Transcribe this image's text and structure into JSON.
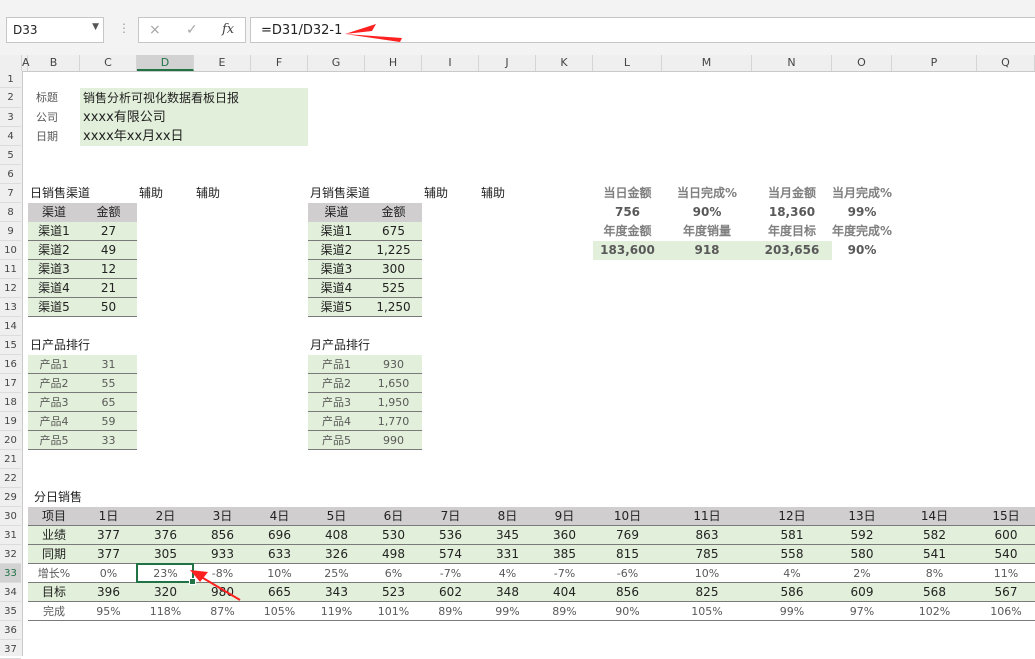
{
  "formula_bar": {
    "name_box": "D33",
    "formula": "=D31/D32-1",
    "cancel_icon": "×",
    "confirm_icon": "✓",
    "fx_label": "fx"
  },
  "columns": [
    "A",
    "B",
    "C",
    "D",
    "E",
    "F",
    "G",
    "H",
    "I",
    "J",
    "K",
    "L",
    "M",
    "N",
    "O",
    "P",
    "Q"
  ],
  "rows": [
    "1",
    "2",
    "3",
    "4",
    "5",
    "6",
    "7",
    "8",
    "9",
    "10",
    "11",
    "12",
    "13",
    "14",
    "15",
    "16",
    "17",
    "18",
    "19",
    "20",
    "21",
    "22",
    "29",
    "30",
    "31",
    "32",
    "33",
    "34",
    "35",
    "36",
    "37"
  ],
  "header_info": {
    "title_label": "标题",
    "title_value": "销售分析可视化数据看板日报",
    "company_label": "公司",
    "company_value": "xxxx有限公司",
    "date_label": "日期",
    "date_value": "xxxx年xx月xx日"
  },
  "daily_channel": {
    "heading": "日销售渠道",
    "aux1": "辅助",
    "aux2": "辅助",
    "col1": "渠道",
    "col2": "金额",
    "rows": [
      [
        "渠道1",
        "27"
      ],
      [
        "渠道2",
        "49"
      ],
      [
        "渠道3",
        "12"
      ],
      [
        "渠道4",
        "21"
      ],
      [
        "渠道5",
        "50"
      ]
    ]
  },
  "monthly_channel": {
    "heading": "月销售渠道",
    "aux1": "辅助",
    "aux2": "辅助",
    "col1": "渠道",
    "col2": "金额",
    "rows": [
      [
        "渠道1",
        "675"
      ],
      [
        "渠道2",
        "1,225"
      ],
      [
        "渠道3",
        "300"
      ],
      [
        "渠道4",
        "525"
      ],
      [
        "渠道5",
        "1,250"
      ]
    ]
  },
  "kpi": {
    "labels1": [
      "当日金额",
      "当日完成%",
      "当月金额",
      "当月完成%"
    ],
    "values1": [
      "756",
      "90%",
      "18,360",
      "99%"
    ],
    "labels2": [
      "年度金额",
      "年度销量",
      "年度目标",
      "年度完成%"
    ],
    "values2": [
      "183,600",
      "918",
      "203,656",
      "90%"
    ]
  },
  "daily_product": {
    "heading": "日产品排行",
    "rows": [
      [
        "产品1",
        "31"
      ],
      [
        "产品2",
        "55"
      ],
      [
        "产品3",
        "65"
      ],
      [
        "产品4",
        "59"
      ],
      [
        "产品5",
        "33"
      ]
    ]
  },
  "monthly_product": {
    "heading": "月产品排行",
    "rows": [
      [
        "产品1",
        "930"
      ],
      [
        "产品2",
        "1,650"
      ],
      [
        "产品3",
        "1,950"
      ],
      [
        "产品4",
        "1,770"
      ],
      [
        "产品5",
        "990"
      ]
    ]
  },
  "daily_sales": {
    "heading": "分日销售",
    "header": [
      "项目",
      "1日",
      "2日",
      "3日",
      "4日",
      "5日",
      "6日",
      "7日",
      "8日",
      "9日",
      "10日",
      "11日",
      "12日",
      "13日",
      "14日",
      "15日"
    ],
    "performance": [
      "业绩",
      "377",
      "376",
      "856",
      "696",
      "408",
      "530",
      "536",
      "345",
      "360",
      "769",
      "863",
      "581",
      "592",
      "582",
      "600"
    ],
    "same_period": [
      "同期",
      "377",
      "305",
      "933",
      "633",
      "326",
      "498",
      "574",
      "331",
      "385",
      "815",
      "785",
      "558",
      "580",
      "541",
      "540"
    ],
    "growth": [
      "增长%",
      "0%",
      "23%",
      "-8%",
      "10%",
      "25%",
      "6%",
      "-7%",
      "4%",
      "-7%",
      "-6%",
      "10%",
      "4%",
      "2%",
      "8%",
      "11%"
    ],
    "target": [
      "目标",
      "396",
      "320",
      "980",
      "665",
      "343",
      "523",
      "602",
      "348",
      "404",
      "856",
      "825",
      "586",
      "609",
      "568",
      "567"
    ],
    "completion": [
      "完成",
      "95%",
      "118%",
      "87%",
      "105%",
      "119%",
      "101%",
      "89%",
      "99%",
      "89%",
      "90%",
      "105%",
      "99%",
      "97%",
      "102%",
      "106%"
    ]
  }
}
